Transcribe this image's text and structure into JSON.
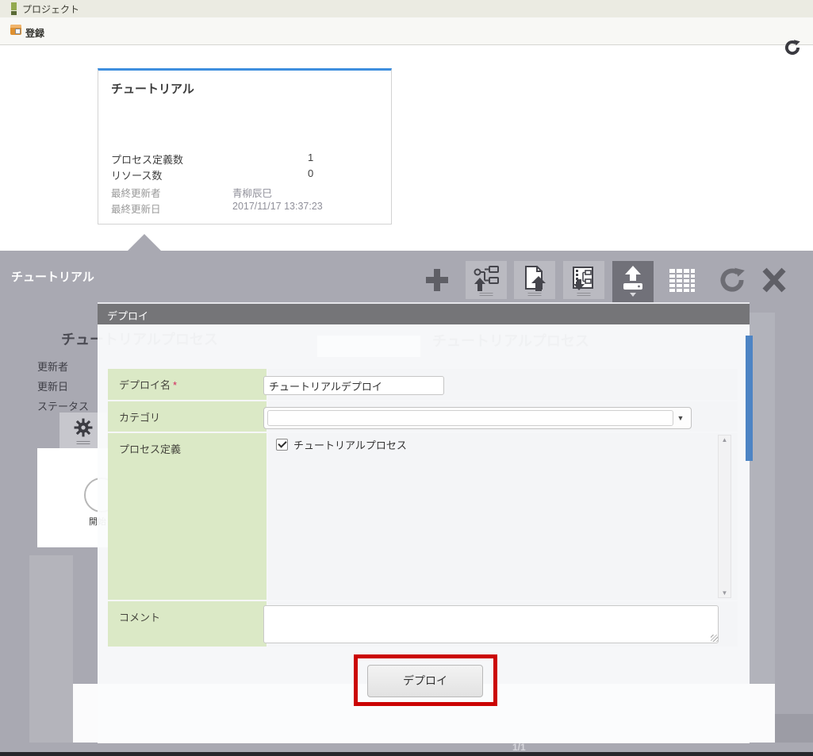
{
  "topbar": {
    "title": "プロジェクト"
  },
  "subbar": {
    "title": "登録"
  },
  "project_card": {
    "title": "チュートリアル",
    "stats": [
      {
        "label": "プロセス定義数",
        "value": "1"
      },
      {
        "label": "リソース数",
        "value": "0"
      }
    ],
    "meta": [
      {
        "label": "最終更新者",
        "value": "青柳辰巳"
      },
      {
        "label": "最終更新日",
        "value": "2017/11/17 13:37:23"
      }
    ]
  },
  "panel": {
    "title": "チュートリアル",
    "background": {
      "process_title_left": "チュートリアルプロセス",
      "process_title_right": "チュートリアルプロセス",
      "meta_labels": [
        "更新者",
        "更新日",
        "ステータス"
      ],
      "start_node_label": "開始",
      "pagination": "1/1"
    }
  },
  "dialog": {
    "title": "デプロイ",
    "deploy_name": {
      "label": "デプロイ名",
      "required_mark": "*",
      "value": "チュートリアルデプロイ"
    },
    "category": {
      "label": "カテゴリ",
      "value": ""
    },
    "process_definition": {
      "label": "プロセス定義",
      "items": [
        {
          "label": "チュートリアルプロセス",
          "checked": true
        }
      ]
    },
    "comment": {
      "label": "コメント",
      "value": ""
    },
    "submit_label": "デプロイ"
  },
  "icons": {
    "plus": "+",
    "dropdown": "▼",
    "scroll_up": "▲",
    "scroll_down": "▼"
  },
  "colors": {
    "accent_blue": "#3e8ede",
    "panel_gray": "#a9a9b2",
    "label_green": "#dbe9c6",
    "annotation_red": "#cb0404",
    "selected_tool": "#717179"
  }
}
